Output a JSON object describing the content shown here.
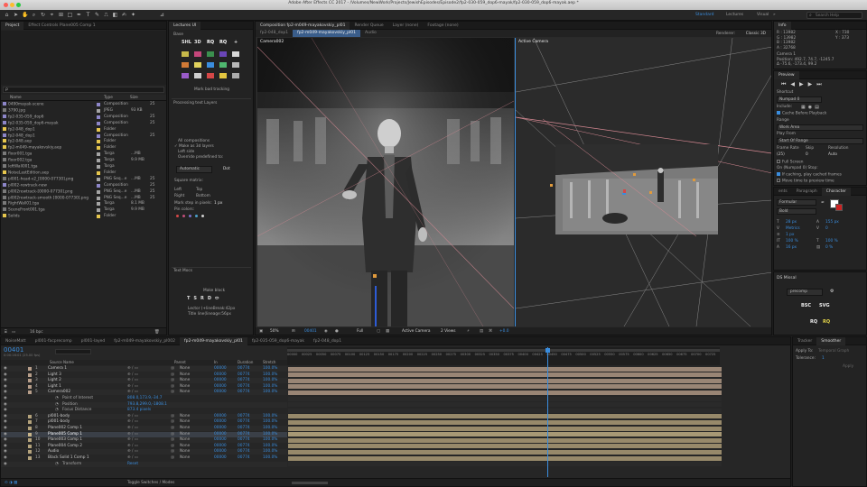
{
  "window": {
    "title": "Adobe After Effects CC 2017 - /Volumes/NewWork/Projects/JewishEpisodes/Episode2/fp2-030-059_dop6-mayak/fp2-030-059_dop6-mayak.aep *"
  },
  "workspaces": {
    "standard": "Standard",
    "lectures": "Lectures",
    "visual": "Visual",
    "search_placeholder": "Search Help"
  },
  "project": {
    "tab": "Project",
    "effect_controls_tab": "Effect Controls Plane005 Comp 1",
    "search_placeholder": "ρ",
    "col_name": "Name",
    "col_type": "Type",
    "col_size": "Size",
    "footer_bpc": "16 bpc",
    "items": [
      {
        "name": "0490mayak-scene",
        "type": "Composition",
        "size": "",
        "num": "25",
        "color": "#8d86c9"
      },
      {
        "name": "3790.jpg",
        "type": "JPEG",
        "size": "93 KB",
        "num": "",
        "color": "#a5a5a5"
      },
      {
        "name": "fp2-035-059_dop6",
        "type": "Composition",
        "size": "",
        "num": "25",
        "color": "#8d86c9"
      },
      {
        "name": "fp2-035-059_dop6-mayak",
        "type": "Composition",
        "size": "",
        "num": "25",
        "color": "#8d86c9"
      },
      {
        "name": "fp2-048_dop1",
        "type": "Folder",
        "size": "",
        "num": "",
        "color": "#e6c64d"
      },
      {
        "name": "fp2-048_dop1",
        "type": "Composition",
        "size": "",
        "num": "25",
        "color": "#8d86c9"
      },
      {
        "name": "fp2-048.aep",
        "type": "Folder",
        "size": "",
        "num": "",
        "color": "#e6c64d"
      },
      {
        "name": "fp2-m049-mayakovskiy.aep",
        "type": "Folder",
        "size": "",
        "num": "",
        "color": "#e6c64d"
      },
      {
        "name": "floor001.tga",
        "type": "Targa",
        "size": "...MB",
        "num": "",
        "color": "#a5a5a5"
      },
      {
        "name": "floor002.tga",
        "type": "Targa",
        "size": "9.9 MB",
        "num": "",
        "color": "#a5a5a5"
      },
      {
        "name": "leftWall001.tga",
        "type": "Targa",
        "size": "",
        "num": "",
        "color": "#a5a5a5"
      },
      {
        "name": "NoiseLastEdition.aep",
        "type": "Folder",
        "size": "",
        "num": "",
        "color": "#e6c64d"
      },
      {
        "name": "pl001-head-v2_[0000-07730].png",
        "type": "PNG Seq...e",
        "size": "...MB",
        "num": "25",
        "color": "#a5a5a5"
      },
      {
        "name": "pl002-rewtrack-new",
        "type": "Composition",
        "size": "",
        "num": "25",
        "color": "#8d86c9"
      },
      {
        "name": "pl002rewtrack-[0000-07730].png",
        "type": "PNG Seq...e",
        "size": "...MB",
        "num": "25",
        "color": "#a5a5a5"
      },
      {
        "name": "pl002rewtrack-smooth [0000-07730].png",
        "type": "PNG Seq...e",
        "size": "...MB",
        "num": "25",
        "color": "#a5a5a5"
      },
      {
        "name": "RightWall01.tga",
        "type": "Targa",
        "size": "8.1 MB",
        "num": "",
        "color": "#a5a5a5"
      },
      {
        "name": "SceneFront001.tga",
        "type": "Targa",
        "size": "9.9 MB",
        "num": "",
        "color": "#a5a5a5"
      },
      {
        "name": "Solids",
        "type": "Folder",
        "size": "",
        "num": "",
        "color": "#e6c64d"
      }
    ]
  },
  "lectures": {
    "title": "Lectures UI",
    "section_base": "Base",
    "mark_label": "Mark bad tracking",
    "processing": "Processing text Layers",
    "opt_all": "All compositions",
    "opt_make": "Make as 3d layers",
    "opt_leftside": "Left side",
    "opt_override": "Override predefined to:",
    "automatic": "Automatic",
    "dot": "Dot",
    "square_matrix": "Square matrix:",
    "left": "Left",
    "top": "Top",
    "right": "Right",
    "bottom": "Bottom",
    "mark_step": "Mark step in pixels:",
    "step_val": "1 px",
    "pin_colors": "Pin colors:",
    "text_mocs": "Text Mocs",
    "make_block": "Make block",
    "formula1": "Lector (+lineBreak:42px",
    "formula2": "Title line(lineage:56px",
    "tool_labels": [
      "SHL",
      "3D",
      "RQ",
      "RQ",
      "+"
    ]
  },
  "viewer": {
    "tabs": [
      "Composition fp2-m049-mayakovskiy_pl01",
      "Render Queue",
      "Layer (none)",
      "Footage (none)"
    ],
    "subtabs": [
      "fp2-048_dop1",
      "fp2-m049-mayakovskiy_pl01",
      "Audio"
    ],
    "renderer_label": "Renderer:",
    "renderer_value": "Classic 3D",
    "left_view_label": "Camera002",
    "right_view_label": "Active Camera",
    "zoom": "50%",
    "timecode": "00401",
    "quality": "Full",
    "camera": "Active Camera",
    "views": "2 Views",
    "exposure": "+0.0"
  },
  "info": {
    "tab": "Info",
    "r": "R : 13982",
    "g": "G : 13982",
    "b": "B : 13982",
    "a": "A : 32768",
    "x": "X : 730",
    "y": "Y : 373",
    "layer": "Camera 1",
    "position": "Position: 492.7, 74.7, -1245.7",
    "rotation": "Δ -75.6, -173.4, 99.2"
  },
  "preview": {
    "tab": "Preview",
    "shortcut_label": "Shortcut",
    "shortcut_value": "Numpad 0",
    "include": "Include:",
    "cache": "Cache Before Playback",
    "range_label": "Range",
    "range_value": "Work Area",
    "play_from_label": "Play From",
    "play_from_value": "Start Of Range",
    "frame_rate": "Frame Rate",
    "skip": "Skip",
    "resolution": "Resolution",
    "fr_value": "(25)",
    "skip_value": "0",
    "res_value": "Auto",
    "full_screen": "Full Screen",
    "on_stop": "On (Numpad 0) Stop:",
    "opt1": "If caching, play cached frames",
    "opt2": "Move time to preview time"
  },
  "character": {
    "tabs": [
      "ents",
      "Paragraph",
      "Character"
    ],
    "font": "Formular",
    "style": "Bold",
    "size": "28 px",
    "leading": "155 px",
    "metrics": "Metrics",
    "tracking": "0",
    "stroke": "1 px",
    "scale_v": "100 %",
    "scale_h": "100 %",
    "baseline": "16 px",
    "tsume": "0 %"
  },
  "ds": {
    "title": "DS Missal",
    "dropdown": "precomp",
    "buttons": [
      "BSC",
      "SVG",
      "RQ",
      "RQ"
    ]
  },
  "timeline_tabs": [
    "NoiseMatt",
    "pl001-facprecomp",
    "pl001-layed",
    "fp2-m049-mayakovskiy_pl002",
    "fp2-m049-mayakovskiy_pl01",
    "fp2-035-059_dop6-mayak",
    "fp2-048_dop1"
  ],
  "timeline": {
    "timecode": "00401",
    "timecode_sub": "0:00:16:01 (25.00 fps)",
    "cols": [
      "Source Name",
      "Parent",
      "In",
      "Duration",
      "Stretch"
    ],
    "ruler": [
      "00000",
      "00025",
      "00050",
      "00075",
      "00100",
      "00125",
      "00150",
      "00175",
      "00200",
      "00225",
      "00250",
      "00275",
      "00300",
      "00325",
      "00350",
      "00375",
      "00400",
      "00425",
      "00450",
      "00475",
      "00500",
      "00525",
      "00550",
      "00575",
      "00600",
      "00625",
      "00650",
      "00675",
      "00700",
      "00725"
    ],
    "footer": "Toggle Switches / Modes",
    "layers": [
      {
        "num": "1",
        "name": "Camera 1",
        "parent": "None",
        "in": "00000",
        "dur": "00774",
        "str": "100.0%",
        "kind": "camera",
        "color": "#b79e8a"
      },
      {
        "num": "2",
        "name": "Light 3",
        "parent": "None",
        "in": "00000",
        "dur": "00774",
        "str": "100.0%",
        "kind": "light",
        "color": "#b79e8a"
      },
      {
        "num": "3",
        "name": "Light 2",
        "parent": "None",
        "in": "00000",
        "dur": "00774",
        "str": "100.0%",
        "kind": "light",
        "color": "#b79e8a"
      },
      {
        "num": "4",
        "name": "Light 1",
        "parent": "None",
        "in": "00000",
        "dur": "00774",
        "str": "100.0%",
        "kind": "light",
        "color": "#b79e8a"
      },
      {
        "num": "5",
        "name": "Camera002",
        "parent": "None",
        "in": "00000",
        "dur": "00774",
        "str": "100.0%",
        "kind": "camera",
        "color": "#b79e8a"
      },
      {
        "num": "",
        "name": "Point of Interest",
        "value": "808.0,173.9,-34.7",
        "kind": "prop"
      },
      {
        "num": "",
        "name": "Position",
        "value": "793.8,299.0,-1808.1",
        "kind": "prop"
      },
      {
        "num": "",
        "name": "Focus Distance",
        "value": "873.4 pixels",
        "kind": "prop"
      },
      {
        "num": "6",
        "name": "pl001-body",
        "parent": "None",
        "in": "00000",
        "dur": "00774",
        "str": "100.0%",
        "kind": "layer",
        "color": "#b4a37c"
      },
      {
        "num": "7",
        "name": "pl001-body",
        "parent": "None",
        "in": "00000",
        "dur": "00774",
        "str": "100.0%",
        "kind": "layer",
        "color": "#b4a37c"
      },
      {
        "num": "8",
        "name": "Plane002 Comp 1",
        "parent": "None",
        "in": "00000",
        "dur": "00774",
        "str": "100.0%",
        "kind": "layer",
        "color": "#b4a37c"
      },
      {
        "num": "9",
        "name": "Plane005 Comp 1",
        "parent": "None",
        "in": "00000",
        "dur": "00774",
        "str": "100.0%",
        "kind": "layer-sel",
        "color": "#c8b58a"
      },
      {
        "num": "10",
        "name": "Plane003 Comp 1",
        "parent": "None",
        "in": "00000",
        "dur": "00774",
        "str": "100.0%",
        "kind": "layer",
        "color": "#b4a37c"
      },
      {
        "num": "11",
        "name": "Plane004 Comp 2",
        "parent": "None",
        "in": "00000",
        "dur": "00774",
        "str": "100.0%",
        "kind": "layer",
        "color": "#b4a37c"
      },
      {
        "num": "12",
        "name": "Audio",
        "parent": "None",
        "in": "00000",
        "dur": "00774",
        "str": "100.0%",
        "kind": "layer",
        "color": "#b4a37c"
      },
      {
        "num": "13",
        "name": "Black Solid 1 Comp 1",
        "parent": "None",
        "in": "00000",
        "dur": "00774",
        "str": "100.0%",
        "kind": "layer",
        "color": "#b4a37c"
      },
      {
        "num": "",
        "name": "Transform",
        "value": "Reset",
        "kind": "prop"
      }
    ]
  },
  "tracker": {
    "tabs": [
      "Tracker",
      "Smoother"
    ],
    "apply_to": "Apply To:",
    "apply_value": "Temporal Graph",
    "tolerance": "Tolerance:",
    "tolerance_value": "1",
    "apply_btn": "Apply"
  }
}
